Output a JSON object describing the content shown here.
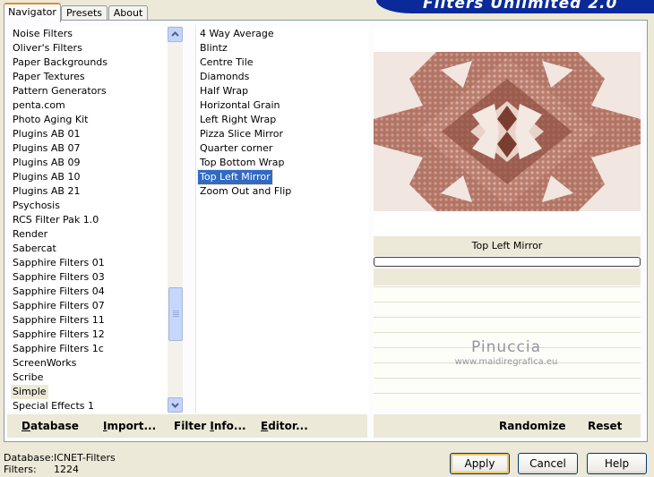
{
  "app_title": "Filters Unlimited 2.0",
  "tabs": [
    "Navigator",
    "Presets",
    "About"
  ],
  "categories": [
    "Noise Filters",
    "Oliver's Filters",
    "Paper Backgrounds",
    "Paper Textures",
    "Pattern Generators",
    "penta.com",
    "Photo Aging Kit",
    "Plugins AB 01",
    "Plugins AB 07",
    "Plugins AB 09",
    "Plugins AB 10",
    "Plugins AB 21",
    "Psychosis",
    "RCS Filter Pak 1.0",
    "Render",
    "Sabercat",
    "Sapphire Filters 01",
    "Sapphire Filters 03",
    "Sapphire Filters 04",
    "Sapphire Filters 07",
    "Sapphire Filters 11",
    "Sapphire Filters 12",
    "Sapphire Filters 1c",
    "ScreenWorks",
    "Scribe",
    "Simple",
    "Special Effects 1"
  ],
  "selected_category": "Simple",
  "filters": [
    "4 Way Average",
    "Blintz",
    "Centre Tile",
    "Diamonds",
    "Half Wrap",
    "Horizontal Grain",
    "Left Right Wrap",
    "Pizza Slice Mirror",
    "Quarter corner",
    "Top Bottom Wrap",
    "Top Left Mirror",
    "Zoom Out and Flip"
  ],
  "selected_filter": "Top Left Mirror",
  "left_buttons": {
    "database": "Database",
    "import": "Import...",
    "filter_info": "Filter Info...",
    "editor": "Editor..."
  },
  "right_buttons": {
    "randomize": "Randomize",
    "reset": "Reset"
  },
  "preview_filter_name": "Top Left Mirror",
  "watermark": {
    "line1": "Pinuccia",
    "line2": "www.maidiregrafica.eu"
  },
  "status": {
    "database_label": "Database:",
    "database_value": "ICNET-Filters",
    "filters_label": "Filters:",
    "filters_value": "1224"
  },
  "dialog_buttons": {
    "apply": "Apply",
    "cancel": "Cancel",
    "help": "Help"
  },
  "colors": {
    "accent": "#316ac5",
    "title_bar": "#0a2a9a",
    "tab_highlight": "#e68b2c",
    "preview_tone": "#a86454"
  },
  "icons": {
    "scroll_up": "chevron-up-icon",
    "scroll_down": "chevron-down-icon"
  }
}
